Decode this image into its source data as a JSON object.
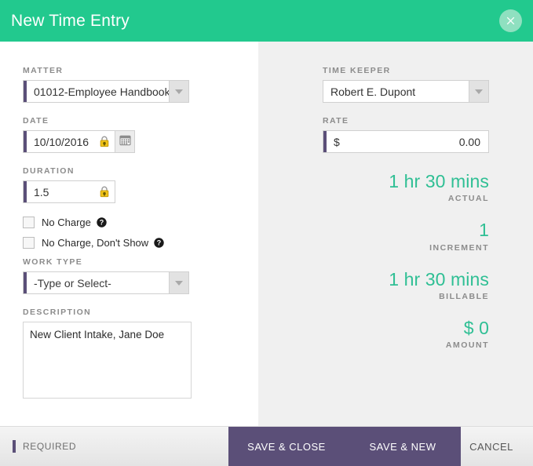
{
  "header": {
    "title": "New Time Entry",
    "close_icon": "close-icon"
  },
  "left": {
    "matter": {
      "label": "MATTER",
      "value": "01012-Employee Handbook",
      "required": true,
      "caret_icon": "chevron-down-icon"
    },
    "date": {
      "label": "DATE",
      "value": "10/10/2016",
      "required": true,
      "lock_icon": "lock-icon",
      "calendar_icon": "calendar-icon"
    },
    "duration": {
      "label": "DURATION",
      "value": "1.5",
      "required": true,
      "lock_icon": "lock-icon"
    },
    "no_charge": {
      "label": "No Charge",
      "checked": false,
      "help_icon": "help-icon"
    },
    "no_charge_dont_show": {
      "label": "No Charge, Don't Show",
      "checked": false,
      "help_icon": "help-icon"
    },
    "work_type": {
      "label": "WORK TYPE",
      "value": "-Type or Select-",
      "required": true,
      "caret_icon": "chevron-down-icon"
    },
    "description": {
      "label": "DESCRIPTION",
      "value": "New Client Intake, Jane Doe"
    }
  },
  "right": {
    "time_keeper": {
      "label": "TIME KEEPER",
      "value": "Robert E. Dupont",
      "caret_icon": "chevron-down-icon"
    },
    "rate": {
      "label": "RATE",
      "currency": "$",
      "value": "0.00",
      "required": true
    },
    "stats": [
      {
        "value": "1 hr 30 mins",
        "caption": "ACTUAL"
      },
      {
        "value": "1",
        "caption": "INCREMENT"
      },
      {
        "value": "1 hr 30 mins",
        "caption": "BILLABLE"
      },
      {
        "value": "$ 0",
        "caption": "AMOUNT"
      }
    ]
  },
  "footer": {
    "required_text": "REQUIRED",
    "save_close_label": "SAVE & CLOSE",
    "save_new_label": "SAVE & NEW",
    "cancel_label": "CANCEL"
  },
  "colors": {
    "header_green": "#22c98e",
    "accent_green": "#2fbf94",
    "required_purple": "#5b4f78",
    "panel_gray": "#f0f0f0",
    "lock_gold": "#e8b320"
  }
}
